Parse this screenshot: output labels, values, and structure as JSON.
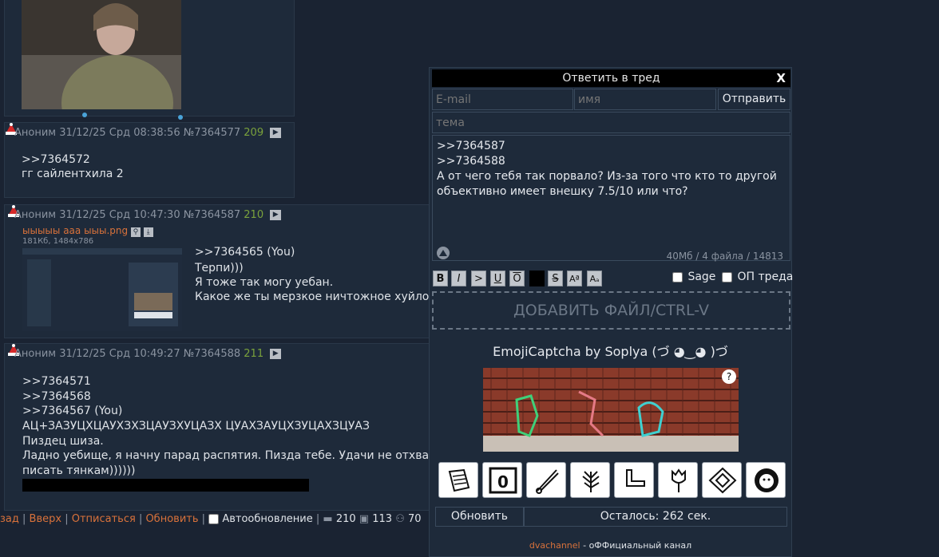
{
  "posts": [
    {
      "header": "Аноним 31/12/25 Срд 08:38:56 №7364577",
      "count": "209",
      "refs": [
        ">>7364572"
      ],
      "lines": [
        "гг сайлентхила 2"
      ]
    },
    {
      "header": "Аноним 31/12/25 Срд 10:47:30 №7364587",
      "count": "210",
      "file_name": "ыыыыы ааа ыыы.png",
      "file_meta": "181Кб, 1484x786",
      "refs": [
        ">>7364565 (You)"
      ],
      "lines": [
        "Терпи)))",
        "Я тоже так могу уебан.",
        "Какое же ты мерзкое ничтожное хуйло"
      ]
    },
    {
      "header": "Аноним 31/12/25 Срд 10:49:27 №7364588",
      "count": "211",
      "refs": [
        ">>7364571",
        ">>7364568",
        ">>7364567 (You)"
      ],
      "lines": [
        "АЦ+ЗАЗУЦХЦАУХЗХЗЦАУЗХУЦАЗХ ЦУАХЗАУЦХЗУЦАХЗЦУАЗ",
        "Пиздец шиза.",
        "Ладно уебище, я начну парад распятия. Пизда тебе. Удачи не отхва",
        "писать тянкам))))))"
      ]
    }
  ],
  "reply": {
    "title": "Ответить в тред",
    "close": "X",
    "email_placeholder": "E-mail",
    "name_placeholder": "имя",
    "submit": "Отправить",
    "subject_placeholder": "тема",
    "message_lines": [
      ">>7364587",
      ">>7364588",
      "А от чего тебя так порвало? Из-за того что кто то другой",
      "объективно имеет внешку 7.5/10 или что?"
    ],
    "limits": "40Мб / 4 файла / 14813",
    "format_buttons": [
      "B",
      "I",
      ">",
      "U",
      "O",
      "",
      "S",
      "Aª",
      "Aₐ"
    ],
    "sage": "Sage",
    "op": "ОП треда",
    "add_file": "ДОБАВИТЬ ФАЙЛ/CTRL-V",
    "captcha_title": "EmojiCaptcha by Soplya (づ ◕‿◕ )づ",
    "captcha_help": "?",
    "emojis": [
      "scroll-icon",
      "zero-key-icon",
      "safety-pin-icon",
      "wheat-icon",
      "hand-icon",
      "tulip-icon",
      "diamond-icon",
      "lion-icon"
    ],
    "refresh": "Обновить",
    "remaining": "Осталось: 262 сек.",
    "footer_link": "dvachannel",
    "footer_text": " - оФФициальный канал"
  },
  "bottom_bar": {
    "items": [
      "зад",
      "Вверх",
      "Отписаться",
      "Обновить"
    ],
    "autoupdate": "Автообновление",
    "stat_posts": "210",
    "stat_files": "113",
    "stat_users": "70"
  },
  "colors": {
    "accent": "#d9723b",
    "count": "#7aa23c",
    "bg": "#1a2332"
  }
}
